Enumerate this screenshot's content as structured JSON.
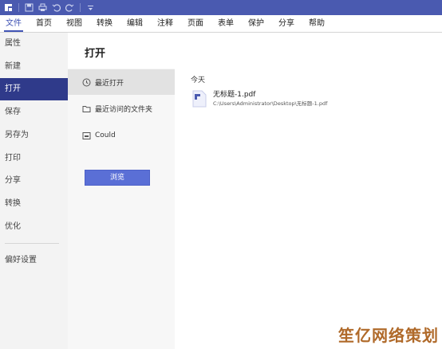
{
  "menubar": {
    "items": [
      {
        "label": "文件"
      },
      {
        "label": "首页"
      },
      {
        "label": "视图"
      },
      {
        "label": "转换"
      },
      {
        "label": "编辑"
      },
      {
        "label": "注释"
      },
      {
        "label": "页面"
      },
      {
        "label": "表单"
      },
      {
        "label": "保护"
      },
      {
        "label": "分享"
      },
      {
        "label": "帮助"
      }
    ]
  },
  "leftnav": {
    "items": [
      {
        "label": "属性"
      },
      {
        "label": "新建"
      },
      {
        "label": "打开"
      },
      {
        "label": "保存"
      },
      {
        "label": "另存为"
      },
      {
        "label": "打印"
      },
      {
        "label": "分享"
      },
      {
        "label": "转换"
      },
      {
        "label": "优化"
      },
      {
        "label": "偏好设置"
      }
    ]
  },
  "main": {
    "title": "打开",
    "subnav": [
      {
        "label": "最近打开",
        "icon": "clock-icon"
      },
      {
        "label": "最近访问的文件夹",
        "icon": "folder-icon"
      },
      {
        "label": "Could",
        "icon": "cloud-drive-icon"
      }
    ],
    "browse_label": "浏览",
    "section_head": "今天",
    "recent_file": {
      "name": "无标题-1.pdf",
      "path": "C:\\Users\\Administrator\\Desktop\\无标题-1.pdf"
    }
  },
  "watermark": "笙亿网络策划",
  "colors": {
    "titlebar": "#4a5ab0",
    "accent": "#4255b5",
    "nav_active": "#2f3a8a",
    "button": "#5a6fd6"
  }
}
